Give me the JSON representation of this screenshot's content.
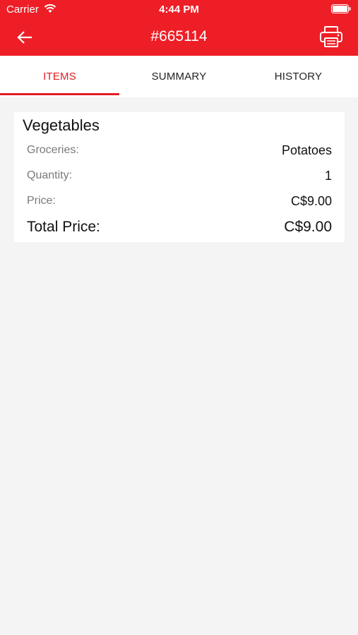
{
  "status_bar": {
    "carrier": "Carrier",
    "time": "4:44 PM"
  },
  "header": {
    "title": "#665114",
    "back_icon": "arrow-left-icon",
    "print_icon": "printer-icon"
  },
  "tabs": [
    {
      "label": "ITEMS",
      "active": true
    },
    {
      "label": "SUMMARY",
      "active": false
    },
    {
      "label": "HISTORY",
      "active": false
    }
  ],
  "item": {
    "category": "Vegetables",
    "groceries_label": "Groceries:",
    "groceries_value": "Potatoes",
    "quantity_label": "Quantity:",
    "quantity_value": "1",
    "price_label": "Price:",
    "price_value": "C$9.00",
    "total_label": "Total Price:",
    "total_value": "C$9.00"
  },
  "colors": {
    "accent": "#ee1e26",
    "background": "#f4f4f4",
    "card": "#ffffff"
  }
}
